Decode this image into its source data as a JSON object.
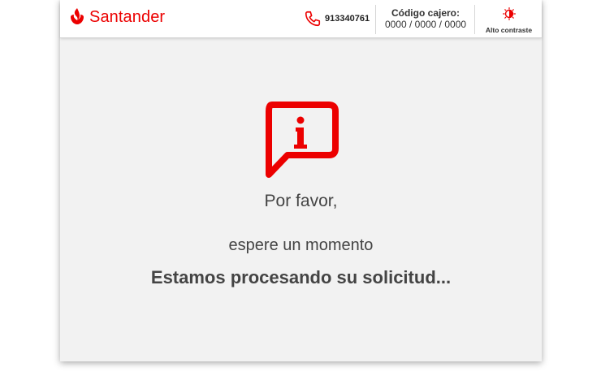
{
  "header": {
    "brand": "Santander",
    "phone_number": "913340761",
    "cajero_label": "Código cajero:",
    "cajero_code": "0000 / 0000 / 0000",
    "contrast_label": "Alto contraste"
  },
  "message": {
    "line1": "Por favor,",
    "line2": "espere un momento",
    "line3": "Estamos procesando su solicitud..."
  },
  "icons": {
    "logo": "santander-flame-icon",
    "phone": "phone-icon",
    "contrast": "contrast-icon",
    "info": "info-speech-bubble-icon"
  },
  "colors": {
    "brand_red": "#ec0000",
    "background": "#f2f2f2",
    "text": "#444444"
  }
}
